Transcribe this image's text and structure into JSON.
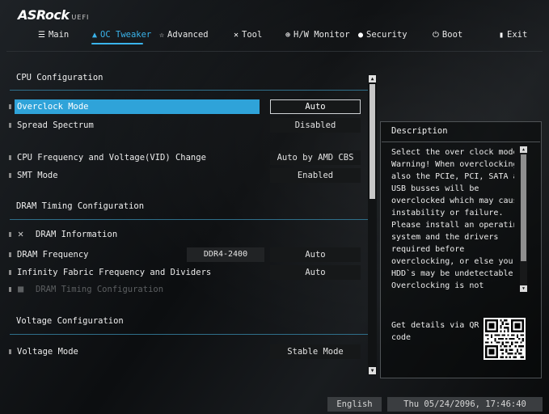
{
  "header": {
    "brand": "ASRock",
    "sub": "UEFI"
  },
  "nav": {
    "tabs": [
      {
        "label": "Main",
        "icon": "list-icon"
      },
      {
        "label": "OC Tweaker",
        "icon": "flame-icon"
      },
      {
        "label": "Advanced",
        "icon": "star-icon"
      },
      {
        "label": "Tool",
        "icon": "tools-icon"
      },
      {
        "label": "H/W Monitor",
        "icon": "monitor-icon"
      },
      {
        "label": "Security",
        "icon": "shield-icon"
      },
      {
        "label": "Boot",
        "icon": "power-icon"
      },
      {
        "label": "Exit",
        "icon": "exit-door-icon"
      }
    ],
    "active": "OC Tweaker"
  },
  "main": {
    "sections": {
      "cpu": "CPU Configuration",
      "dram": "DRAM Timing Configuration",
      "voltage": "Voltage Configuration"
    },
    "rows": [
      {
        "label": "Overclock Mode",
        "value": "Auto",
        "selected": true
      },
      {
        "label": "Spread Spectrum",
        "value": "Disabled"
      },
      {
        "label": "CPU Frequency and Voltage(VID) Change",
        "value": "Auto by AMD CBS"
      },
      {
        "label": "SMT Mode",
        "value": "Enabled"
      },
      {
        "label": "DRAM Information",
        "icon": "tools-icon"
      },
      {
        "label": "DRAM Frequency",
        "secondary": "DDR4-2400",
        "value": "Auto"
      },
      {
        "label": "Infinity Fabric Frequency and Dividers",
        "value": "Auto"
      },
      {
        "label": "DRAM Timing Configuration",
        "icon": "folder-icon",
        "disabled": true
      },
      {
        "label": "Voltage Mode",
        "value": "Stable Mode"
      }
    ]
  },
  "description": {
    "title": "Description",
    "lines": [
      "Select the over clock mode.",
      "Warning! When overclocking",
      "also the PCIe, PCI, SATA and",
      "USB busses will be",
      "overclocked which may cause",
      "instability or failure.",
      "Please install an operating",
      "system and the drivers",
      "required before",
      "overclocking, or else your",
      "HDD`s may be undetectable.",
      "Overclocking is not"
    ],
    "qr_text": "Get details via QR code"
  },
  "footer": {
    "language": "English",
    "datetime": "Thu 05/24/2096, 17:46:40"
  },
  "colors": {
    "accent": "#2fa3d9",
    "active_tab": "#3ab4ec"
  }
}
